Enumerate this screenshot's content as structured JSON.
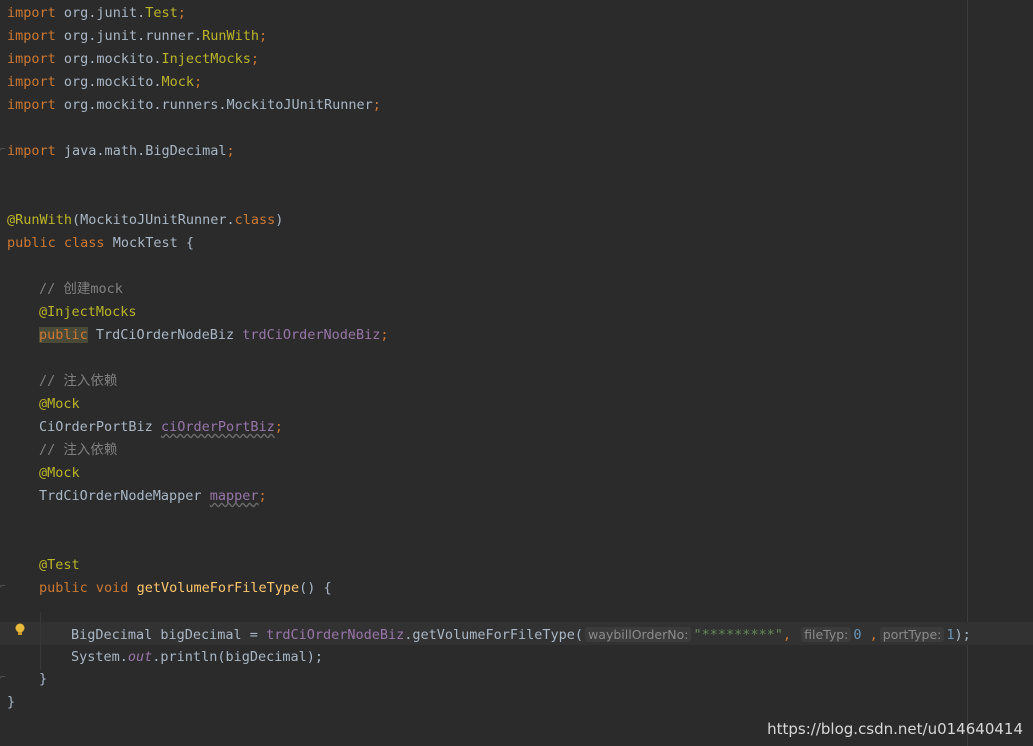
{
  "imports": [
    {
      "kw": "import",
      "pkg": "org.junit.",
      "cls": "Test"
    },
    {
      "kw": "import",
      "pkg": "org.junit.runner.",
      "cls": "RunWith"
    },
    {
      "kw": "import",
      "pkg": "org.mockito.",
      "cls": "InjectMocks"
    },
    {
      "kw": "import",
      "pkg": "org.mockito.",
      "cls": "Mock"
    },
    {
      "kw": "import",
      "pkg": "org.mockito.runners.MockitoJUnitRunner",
      "cls": ""
    },
    {
      "kw": "import",
      "pkg": "java.math.BigDecimal",
      "cls": ""
    }
  ],
  "class_decl": {
    "annotation": "@RunWith",
    "annotation_arg": "(MockitoJUnitRunner.",
    "annotation_kw": "class",
    "annotation_close": ")",
    "mod": "public",
    "kw": "class",
    "name": "MockTest {"
  },
  "fields": {
    "comment1": "// 创建mock",
    "ann1": "@InjectMocks",
    "mod1": "public",
    "type1": "TrdCiOrderNodeBiz",
    "name1": "trdCiOrderNodeBiz",
    "comment2": "// 注入依赖",
    "ann2": "@Mock",
    "type2": "CiOrderPortBiz",
    "name2": "ciOrderPortBiz",
    "comment3": "// 注入依赖",
    "ann3": "@Mock",
    "type3": "TrdCiOrderNodeMapper",
    "name3": "mapper"
  },
  "method": {
    "ann": "@Test",
    "mod": "public",
    "ret": "void",
    "name": "getVolumeForFileType",
    "sig_rest": "() {",
    "stmt1_type": "BigDecimal bigDecimal = ",
    "stmt1_field": "trdCiOrderNodeBiz",
    "stmt1_call": ".getVolumeForFileType(",
    "hint1": "waybillOrderNo:",
    "arg1": "\"*********\"",
    "hint2": "fileTyp:",
    "arg2": "0",
    "hint3": "portType:",
    "arg3": "1",
    "stmt1_close": ");",
    "stmt2_a": "System.",
    "stmt2_out": "out",
    "stmt2_b": ".println(bigDecimal);",
    "close_method": "}",
    "close_class": "}"
  },
  "watermark": "https://blog.csdn.net/u014640414",
  "colors": {
    "background": "#2b2b2b",
    "keyword": "#cc7832",
    "annotation": "#bbb529",
    "field": "#9876aa",
    "comment": "#808080",
    "method": "#ffc66d",
    "string": "#6a8759",
    "number": "#6897bb"
  }
}
